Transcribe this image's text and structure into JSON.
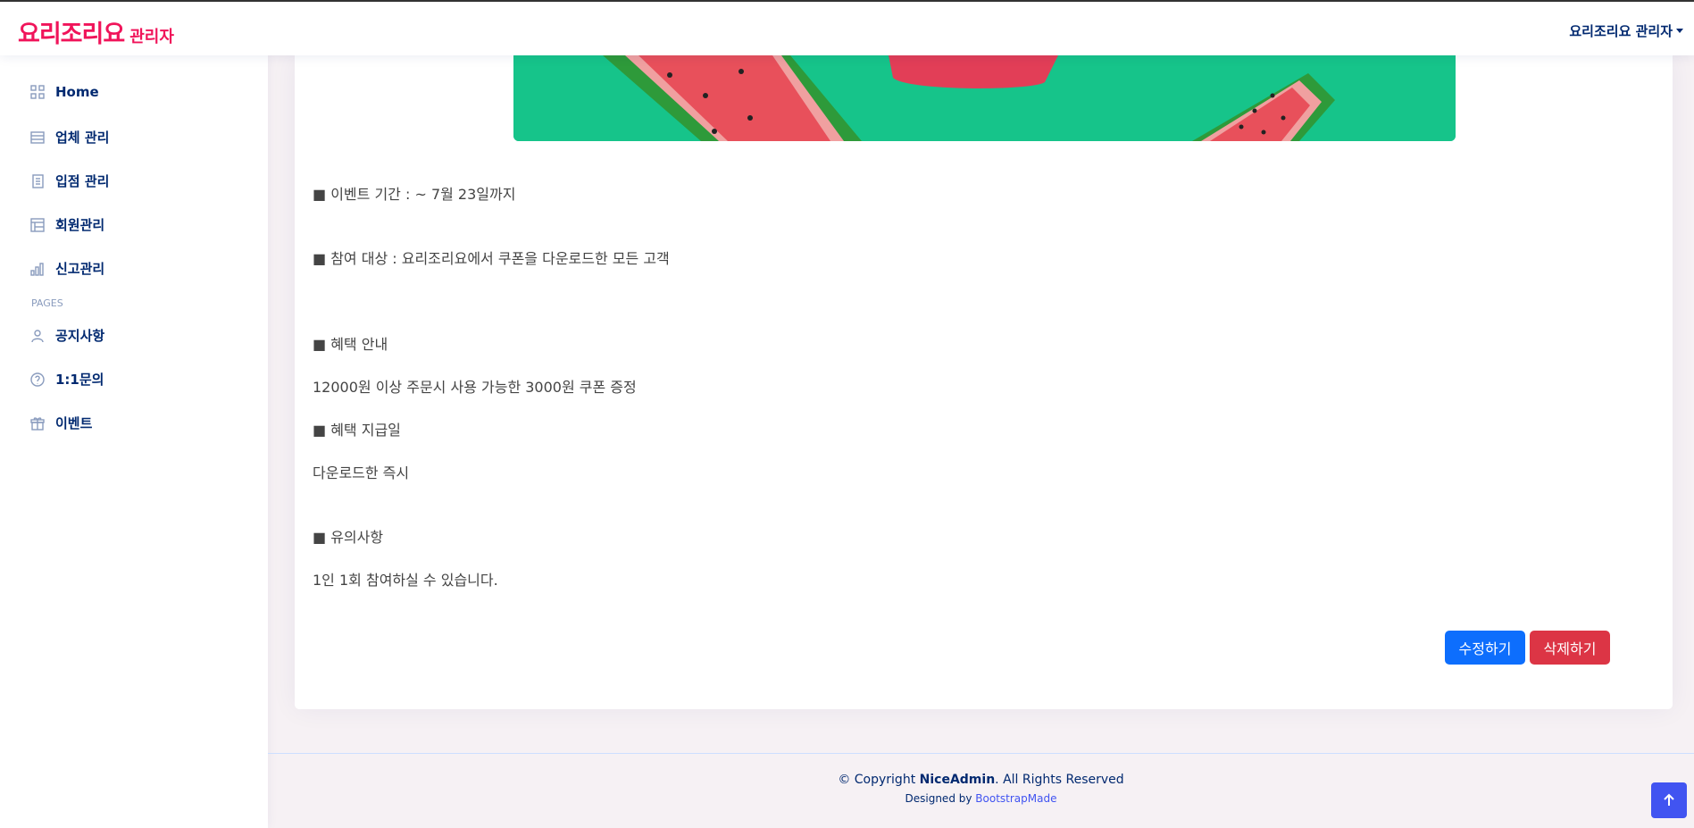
{
  "header": {
    "logo_main": "요리조리요",
    "logo_sub": "관리자",
    "profile_label": "요리조리요 관리자"
  },
  "sidebar": {
    "items": [
      {
        "label": "Home",
        "icon": "grid-icon"
      },
      {
        "label": "업체 관리",
        "icon": "layout-icon"
      },
      {
        "label": "입점 관리",
        "icon": "journal-icon"
      },
      {
        "label": "회원관리",
        "icon": "table-icon"
      },
      {
        "label": "신고관리",
        "icon": "bar-chart-icon"
      }
    ],
    "heading": "PAGES",
    "pages": [
      {
        "label": "공지사항",
        "icon": "person-icon"
      },
      {
        "label": "1:1문의",
        "icon": "question-circle-icon"
      },
      {
        "label": "이벤트",
        "icon": "gift-icon"
      }
    ]
  },
  "event": {
    "lines": [
      "■ 이벤트 기간 : ~ 7월 23일까지",
      "■ 참여 대상 : 요리조리요에서 쿠폰을 다운로드한 모든 고객",
      "■ 혜택 안내",
      "12000원 이상 주문시 사용 가능한 3000원 쿠폰 증정",
      "■ 혜택 지급일",
      "다운로드한 즉시",
      "■ 유의사항",
      "1인 1회 참여하실 수 있습니다."
    ],
    "edit_label": "수정하기",
    "delete_label": "삭제하기"
  },
  "footer": {
    "copyright_prefix": "© Copyright ",
    "brand": "NiceAdmin",
    "copyright_suffix": ". All Rights Reserved",
    "designed_by": "Designed by ",
    "designer": "BootstrapMade"
  },
  "colors": {
    "brand": "#f0145a",
    "nav": "#012970",
    "primary": "#0d6efd",
    "danger": "#dc3545",
    "banner": "#16c48a"
  }
}
